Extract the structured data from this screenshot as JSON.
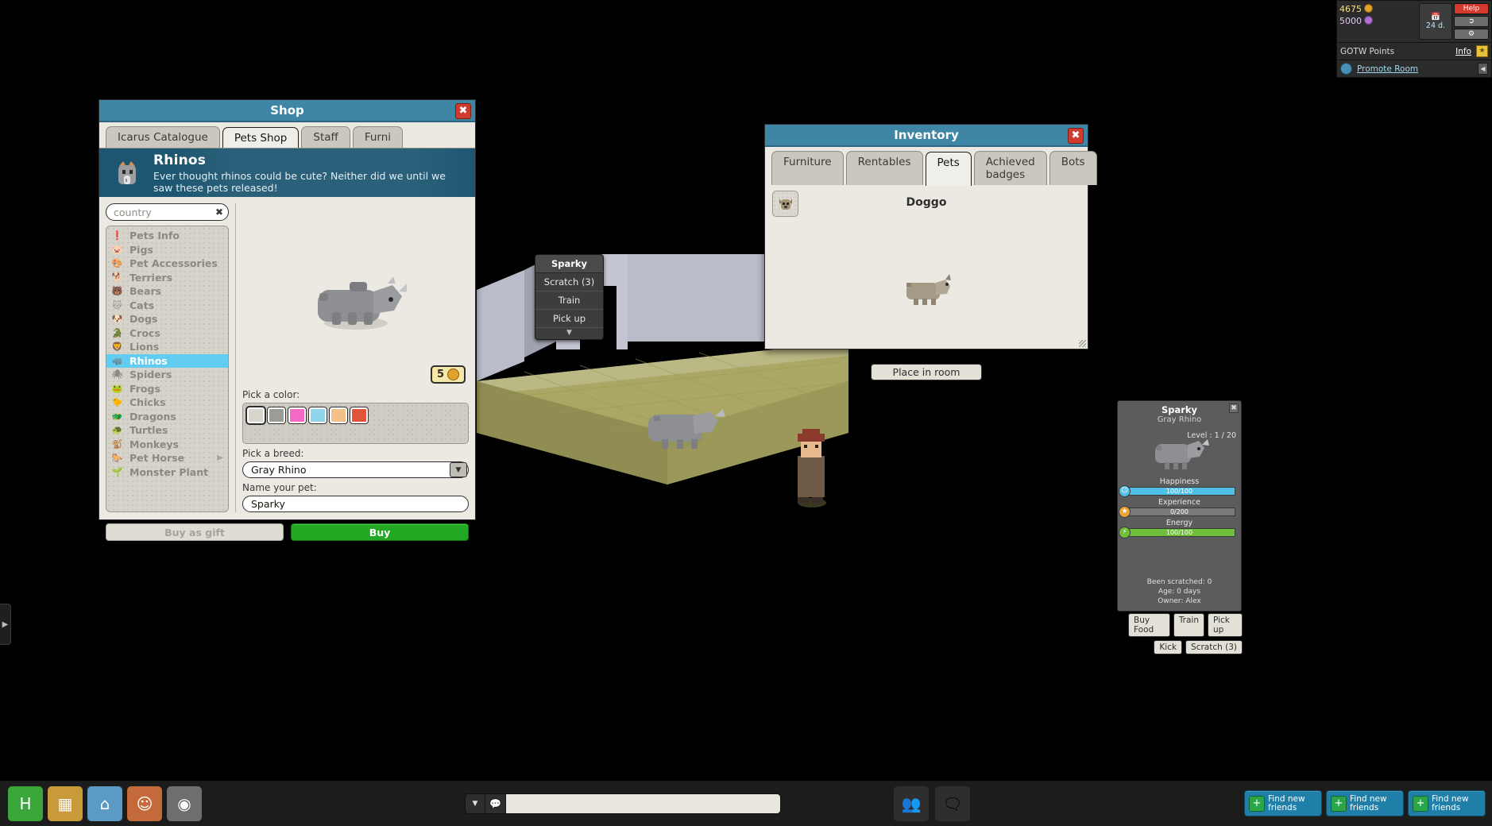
{
  "hud": {
    "credits": "4675",
    "credits_color": "#f0e08a",
    "duckets": "5000",
    "duckets_color": "#e2c9ef",
    "days_value": "24 d.",
    "help_label": "Help",
    "gotw_label": "GOTW Points",
    "gotw_info": "Info",
    "promote_label": "Promote Room",
    "icons": {
      "credit_coin": "coin-icon",
      "ducket_coin": "ducket-icon",
      "calendar": "calendar-icon",
      "logout": "logout-icon",
      "settings": "gear-icon",
      "star": "star-icon",
      "globe": "globe-icon",
      "collapse": "collapse-icon"
    }
  },
  "shop": {
    "title": "Shop",
    "tabs": [
      {
        "label": "Icarus Catalogue",
        "active": false
      },
      {
        "label": "Pets Shop",
        "active": true
      },
      {
        "label": "Staff",
        "active": false
      },
      {
        "label": "Furni",
        "active": false
      }
    ],
    "banner": {
      "title": "Rhinos",
      "description": "Ever thought rhinos could be cute? Neither did we until we saw these pets released!",
      "icon": "rhino-head-icon"
    },
    "search": {
      "value": "country",
      "placeholder": "country",
      "clear_icon": "clear-icon"
    },
    "categories": [
      {
        "label": "Pets Info",
        "icon": "info-icon",
        "active": false,
        "has_arrow": false
      },
      {
        "label": "Pigs",
        "icon": "pig-icon",
        "active": false,
        "has_arrow": false
      },
      {
        "label": "Pet Accessories",
        "icon": "accessories-icon",
        "active": false,
        "has_arrow": false
      },
      {
        "label": "Terriers",
        "icon": "terrier-icon",
        "active": false,
        "has_arrow": false
      },
      {
        "label": "Bears",
        "icon": "bear-icon",
        "active": false,
        "has_arrow": false
      },
      {
        "label": "Cats",
        "icon": "cat-icon",
        "active": false,
        "has_arrow": false
      },
      {
        "label": "Dogs",
        "icon": "dog-icon",
        "active": false,
        "has_arrow": false
      },
      {
        "label": "Crocs",
        "icon": "croc-icon",
        "active": false,
        "has_arrow": false
      },
      {
        "label": "Lions",
        "icon": "lion-icon",
        "active": false,
        "has_arrow": false
      },
      {
        "label": "Rhinos",
        "icon": "rhino-icon",
        "active": true,
        "has_arrow": false
      },
      {
        "label": "Spiders",
        "icon": "spider-icon",
        "active": false,
        "has_arrow": false
      },
      {
        "label": "Frogs",
        "icon": "frog-icon",
        "active": false,
        "has_arrow": false
      },
      {
        "label": "Chicks",
        "icon": "chick-icon",
        "active": false,
        "has_arrow": false
      },
      {
        "label": "Dragons",
        "icon": "dragon-icon",
        "active": false,
        "has_arrow": false
      },
      {
        "label": "Turtles",
        "icon": "turtle-icon",
        "active": false,
        "has_arrow": false
      },
      {
        "label": "Monkeys",
        "icon": "monkey-icon",
        "active": false,
        "has_arrow": false
      },
      {
        "label": "Pet Horse",
        "icon": "horse-icon",
        "active": false,
        "has_arrow": true
      },
      {
        "label": "Monster Plant",
        "icon": "plant-icon",
        "active": false,
        "has_arrow": false
      }
    ],
    "price": "5",
    "price_currency_icon": "credit-coin-icon",
    "color_label": "Pick a color:",
    "colors": [
      {
        "name": "white",
        "hex": "#d7d5cc",
        "selected": true
      },
      {
        "name": "gray",
        "hex": "#9b9b97",
        "selected": false
      },
      {
        "name": "pink",
        "hex": "#f569c4",
        "selected": false
      },
      {
        "name": "blue",
        "hex": "#8ed4ea",
        "selected": false
      },
      {
        "name": "orange",
        "hex": "#f3c089",
        "selected": false
      },
      {
        "name": "red",
        "hex": "#e1543a",
        "selected": false
      }
    ],
    "breed_label": "Pick a breed:",
    "breed_value": "Gray Rhino",
    "name_label": "Name your pet:",
    "name_value": "Sparky",
    "name_placeholder": "Name your pet",
    "buy_gift_label": "Buy as gift",
    "buy_label": "Buy"
  },
  "inventory": {
    "title": "Inventory",
    "tabs": [
      {
        "label": "Furniture",
        "active": false
      },
      {
        "label": "Rentables",
        "active": false
      },
      {
        "label": "Pets",
        "active": true
      },
      {
        "label": "Achieved badges",
        "active": false
      },
      {
        "label": "Bots",
        "active": false
      }
    ],
    "selected_pet_name": "Doggo",
    "slot_icon": "dog-head-icon",
    "place_button": "Place in room"
  },
  "pet_menu": {
    "title": "Sparky",
    "items": [
      "Scratch (3)",
      "Train",
      "Pick up"
    ],
    "caret_icon": "chevron-down-icon"
  },
  "pet_info": {
    "name": "Sparky",
    "breed": "Gray Rhino",
    "level": "Level : 1 / 20",
    "avatar_icon": "rhino-icon",
    "stats": [
      {
        "label": "Happiness",
        "value": "100/100",
        "pct": 100,
        "color": "#4fc0e8",
        "icon": "happy-icon"
      },
      {
        "label": "Experience",
        "value": "0/200",
        "pct": 0,
        "color": "#e8a33a",
        "icon": "star-icon"
      },
      {
        "label": "Energy",
        "value": "100/100",
        "pct": 100,
        "color": "#6fbf3a",
        "icon": "energy-icon"
      }
    ],
    "footer": [
      "Been scratched: 0",
      "Age: 0 days",
      "Owner: Alex"
    ],
    "scratch_icon": "scratch-icon",
    "close_icon": "close-icon",
    "buttons_row1": [
      "Buy Food",
      "Train",
      "Pick up"
    ],
    "buttons_row2": [
      "Kick",
      "Scratch (3)"
    ]
  },
  "toolbar": {
    "icons": [
      {
        "name": "home-icon",
        "glyph": "H",
        "color": "#3aa63a"
      },
      {
        "name": "catalogue-icon",
        "glyph": "▦",
        "color": "#c89a3a"
      },
      {
        "name": "navigator-icon",
        "glyph": "⌂",
        "color": "#5b9ac4"
      },
      {
        "name": "avatar-editor-icon",
        "glyph": "☺",
        "color": "#c46a3a"
      },
      {
        "name": "camera-icon",
        "glyph": "◉",
        "color": "#6e6e6e"
      }
    ],
    "chat_placeholder": "",
    "chat_value": "",
    "chat_caret_icon": "chevron-down-icon",
    "chat_style_icon": "chat-style-icon",
    "people_icon": "people-icon",
    "chat_bubble_icon": "chat-bubble-icon",
    "friend_buttons": [
      {
        "label_line1": "Find new",
        "label_line2": "friends",
        "icon": "add-friend-icon"
      },
      {
        "label_line1": "Find new",
        "label_line2": "friends",
        "icon": "add-friend-icon"
      },
      {
        "label_line1": "Find new",
        "label_line2": "friends",
        "icon": "add-friend-icon"
      }
    ]
  },
  "side_handle": {
    "icon": "chevron-right-icon"
  }
}
